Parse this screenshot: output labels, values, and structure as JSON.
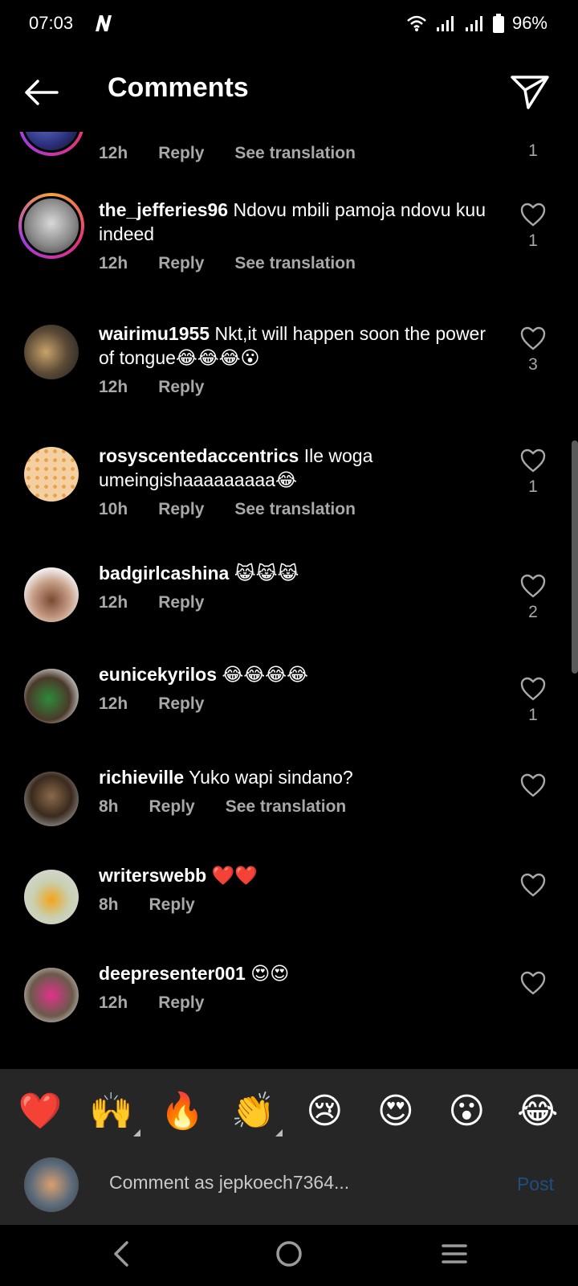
{
  "status_bar": {
    "time": "07:03",
    "battery": "96%"
  },
  "header": {
    "title": "Comments"
  },
  "comments": [
    {
      "username": "",
      "text": "",
      "time": "12h",
      "reply": "Reply",
      "see_translation": "See translation",
      "likes": "1"
    },
    {
      "username": "the_jefferies96",
      "text": "Ndovu mbili pamoja ndovu kuu indeed",
      "time": "12h",
      "reply": "Reply",
      "see_translation": "See translation",
      "likes": "1"
    },
    {
      "username": "wairimu1955",
      "text": "Nkt,it will happen soon the power of tongue😂😂😂😮",
      "time": "12h",
      "reply": "Reply",
      "likes": "3"
    },
    {
      "username": "rosyscentedaccentrics",
      "text": "Ile woga umeingishaaaaaaaaa😂",
      "time": "10h",
      "reply": "Reply",
      "see_translation": "See translation",
      "likes": "1"
    },
    {
      "username": "badgirlcashina",
      "text": "😹😹😹",
      "time": "12h",
      "reply": "Reply",
      "likes": "2"
    },
    {
      "username": "eunicekyrilos",
      "text": "😂😂😂😂",
      "time": "12h",
      "reply": "Reply",
      "likes": "1"
    },
    {
      "username": "richieville",
      "text": "Yuko wapi sindano?",
      "time": "8h",
      "reply": "Reply",
      "see_translation": "See translation",
      "likes": ""
    },
    {
      "username": "writerswebb",
      "text": "❤️❤️",
      "time": "8h",
      "reply": "Reply",
      "likes": ""
    },
    {
      "username": "deepresenter001",
      "text": "😍😍",
      "time": "12h",
      "reply": "Reply",
      "likes": ""
    }
  ],
  "reactions": [
    "❤️",
    "🙌",
    "🔥",
    "👏",
    "😢",
    "😍",
    "😮",
    "😂"
  ],
  "composer": {
    "placeholder": "Comment as jepkoech7364...",
    "post_label": "Post"
  },
  "colors": {
    "background": "#000000",
    "secondary_text": "#a8a8a8",
    "post_disabled": "#1e4f7e",
    "panel": "#262626"
  }
}
